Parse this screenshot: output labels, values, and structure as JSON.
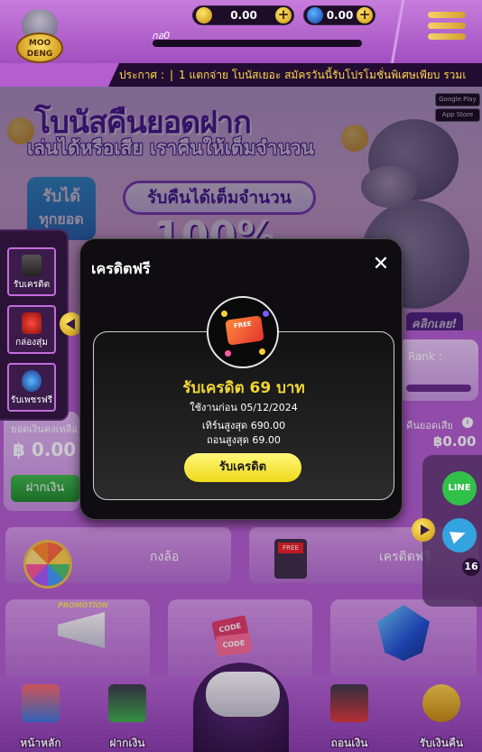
{
  "header": {
    "logo_text": "MOO DENG",
    "username": "กอ0",
    "wallet_coin_amount": "0.00",
    "wallet_gem_amount": "0.00"
  },
  "marquee": {
    "label": "ประกาศ :",
    "text": "1 แตกจ่าย โบนัสเยอะ สมัครวันนี้รับโปรโมชั่นพิเศษเพียบ รวมเ"
  },
  "banner": {
    "title": "โบนัสคืนยอดฝาก",
    "subtitle": "เล่นได้หรือเสีย เราคืนให้เต็มจำนวน",
    "left_box_line1": "รับได้",
    "left_box_line2": "ทุกยอด",
    "pill": "รับคืนได้เต็มจำนวน",
    "big_number": "100%",
    "google_play": "Google Play",
    "app_store": "App Store",
    "cta": "คลิกเลย!"
  },
  "profile": {
    "rank_label": "Rank :",
    "cashback_label": "คืนยอดเสีย",
    "cashback_value": "฿0.00",
    "balance_label": "ยอดเงินคงเหลือ",
    "balance_value": "฿ 0.00",
    "deposit_button": "ฝากเงิน"
  },
  "side_drawer": {
    "items": [
      {
        "label": "รับเครดิต",
        "icon": "credit-icon"
      },
      {
        "label": "กล่องสุ่ม",
        "icon": "gift-box-icon"
      },
      {
        "label": "รับเพชรฟรี",
        "icon": "diamond-icon"
      }
    ]
  },
  "social": {
    "line_label": "LINE",
    "notification_count": "16"
  },
  "menu": {
    "wheel_label": "กงล้อ",
    "free_credit_label": "เครดิตฟรี",
    "promotion_tag": "PROMOTION",
    "code_label": "CODE"
  },
  "bottom_nav": {
    "items": [
      {
        "label": "หน้าหลัก",
        "icon": "home-icon"
      },
      {
        "label": "ฝากเงิน",
        "icon": "deposit-icon"
      },
      {
        "label": "ถอนเงิน",
        "icon": "withdraw-icon"
      },
      {
        "label": "รับเงินคืน",
        "icon": "cashback-icon"
      }
    ]
  },
  "modal": {
    "title": "เครดิตฟรี",
    "close_icon": "close-icon",
    "icon_badge": "FREE",
    "heading": "รับเครดิต 69 บาท",
    "expiry": "ใช้งานก่อน 05/12/2024",
    "min_deposit": "เทิร์นสูงสุด 690.00",
    "max_withdraw": "ถอนสูงสุด 69.00",
    "button": "รับเครดิต"
  },
  "colors": {
    "accent_purple": "#b55fcf",
    "gold": "#f0d91a",
    "modal_bg": "#0f0d12",
    "heading_yellow": "#f2d637"
  }
}
